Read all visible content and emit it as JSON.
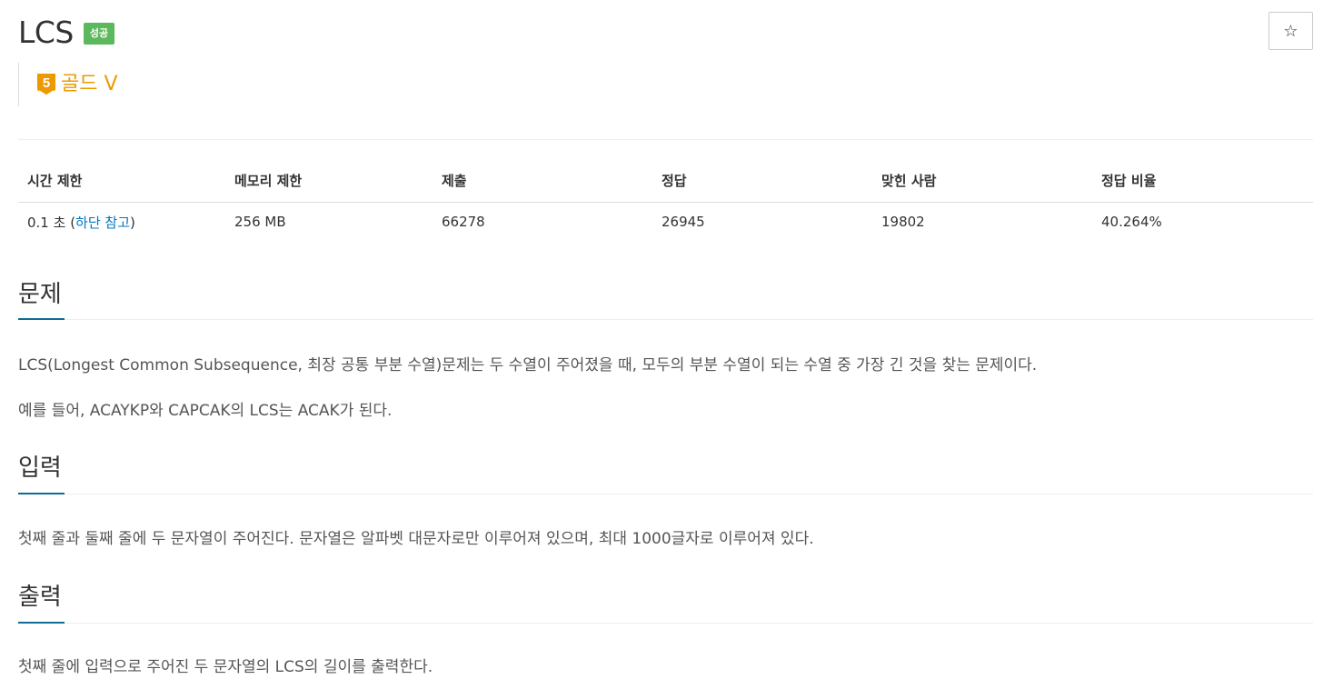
{
  "problem": {
    "title": "LCS",
    "status_badge": "성공",
    "star_icon": "☆",
    "tier": {
      "number": "5",
      "label": "골드 V",
      "color": "#ec9a00"
    }
  },
  "info_table": {
    "headers": [
      "시간 제한",
      "메모리 제한",
      "제출",
      "정답",
      "맞힌 사람",
      "정답 비율"
    ],
    "time_limit_prefix": "0.1 초 (",
    "time_limit_link": "하단 참고",
    "time_limit_suffix": ")",
    "memory_limit": "256 MB",
    "submissions": "66278",
    "accepted": "26945",
    "solvers": "19802",
    "ratio": "40.264%"
  },
  "sections": {
    "problem": {
      "title": "문제",
      "paragraphs": [
        "LCS(Longest Common Subsequence, 최장 공통 부분 수열)문제는 두 수열이 주어졌을 때, 모두의 부분 수열이 되는 수열 중 가장 긴 것을 찾는 문제이다.",
        "예를 들어, ACAYKP와 CAPCAK의 LCS는 ACAK가 된다."
      ]
    },
    "input": {
      "title": "입력",
      "paragraph": "첫째 줄과 둘째 줄에 두 문자열이 주어진다. 문자열은 알파벳 대문자로만 이루어져 있으며, 최대 1000글자로 이루어져 있다."
    },
    "output": {
      "title": "출력",
      "paragraph": "첫째 줄에 입력으로 주어진 두 문자열의 LCS의 길이를 출력한다."
    }
  },
  "colors": {
    "success_badge": "#5cb85c",
    "link": "#0076c0",
    "section_underline": "#0f6d95"
  }
}
